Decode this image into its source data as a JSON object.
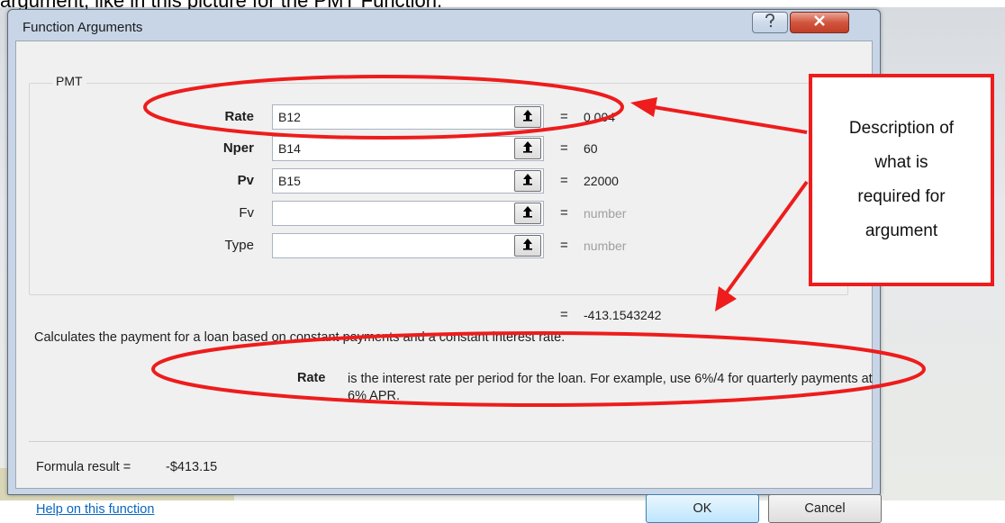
{
  "caption": "argument, like in this picture for the PMT Function.",
  "dialog": {
    "title": "Function Arguments",
    "function_name": "PMT",
    "arguments": [
      {
        "label": "Rate",
        "value": "B12",
        "result": "0.004",
        "bold": true
      },
      {
        "label": "Nper",
        "value": "B14",
        "result": "60",
        "bold": true
      },
      {
        "label": "Pv",
        "value": "B15",
        "result": "22000",
        "bold": true
      },
      {
        "label": "Fv",
        "value": "",
        "result": "number",
        "bold": false
      },
      {
        "label": "Type",
        "value": "",
        "result": "number",
        "bold": false
      }
    ],
    "equals_sign": "=",
    "overall_result": "-413.1543242",
    "description": "Calculates the payment for a loan based on constant payments and a constant interest rate.",
    "argument_help": {
      "name": "Rate",
      "text": "is the interest rate per period for the loan. For example, use 6%/4 for quarterly payments at 6% APR."
    },
    "formula_result_label": "Formula result =",
    "formula_result_value": "-$413.15",
    "help_link": "Help on this function",
    "ok_label": "OK",
    "cancel_label": "Cancel",
    "help_icon": "question-icon",
    "close_icon": "close-icon"
  },
  "callout": {
    "lines": [
      "Description of",
      "what is",
      "required for",
      "argument"
    ],
    "border_color": "#ee1c1c"
  },
  "annotation_color": "#ee1c1c"
}
